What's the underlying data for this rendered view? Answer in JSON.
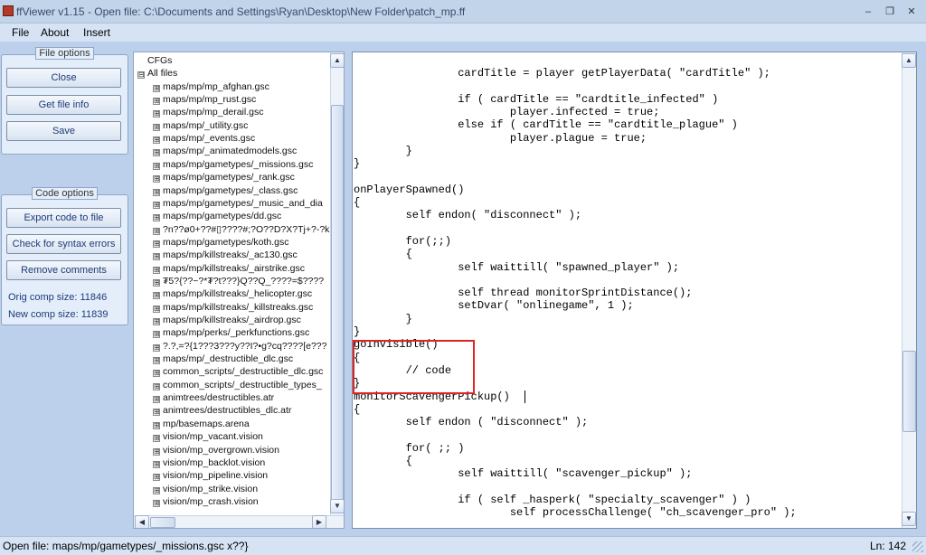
{
  "window": {
    "title": "ffViewer v1.15 - Open file: C:\\Documents and Settings\\Ryan\\Desktop\\New Folder\\patch_mp.ff",
    "minimize": "–",
    "restore": "❐",
    "close": "✕"
  },
  "menu": {
    "items": [
      "File",
      "About",
      "Insert"
    ]
  },
  "file_options": {
    "title": "File options",
    "buttons": [
      "Close",
      "Get file info",
      "Save"
    ]
  },
  "code_options": {
    "title": "Code options",
    "buttons": [
      "Export code to file",
      "Check for syntax errors",
      "Remove comments"
    ],
    "orig_comp_size": "Orig comp size: 11846",
    "new_comp_size": "New comp size: 11839"
  },
  "tree": {
    "roots": [
      {
        "label": "CFGs",
        "expander": ""
      },
      {
        "label": "All files",
        "expander": "⊟"
      }
    ],
    "files": [
      "maps/mp/mp_afghan.gsc",
      "maps/mp/mp_rust.gsc",
      "maps/mp/mp_derail.gsc",
      "maps/mp/_utility.gsc",
      "maps/mp/_events.gsc",
      "maps/mp/_animatedmodels.gsc",
      "maps/mp/gametypes/_missions.gsc",
      "maps/mp/gametypes/_rank.gsc",
      "maps/mp/gametypes/_class.gsc",
      "maps/mp/gametypes/_music_and_dia",
      "maps/mp/gametypes/dd.gsc",
      "?n??ø0+??#▯????#;?O??D?X?Tj+?-?k",
      "maps/mp/gametypes/koth.gsc",
      "maps/mp/killstreaks/_ac130.gsc",
      "maps/mp/killstreaks/_airstrike.gsc",
      "₮5?{??~?*₮?t???}Q??Q_????=$????",
      "maps/mp/killstreaks/_helicopter.gsc",
      "maps/mp/killstreaks/_killstreaks.gsc",
      "maps/mp/killstreaks/_airdrop.gsc",
      "maps/mp/perks/_perkfunctions.gsc",
      "?.?,=?{1???3???y??I?•g?cq????[e???",
      "maps/mp/_destructible_dlc.gsc",
      "common_scripts/_destructible_dlc.gsc",
      "common_scripts/_destructible_types_",
      "animtrees/destructibles.atr",
      "animtrees/destructibles_dlc.atr",
      "mp/basemaps.arena",
      "vision/mp_vacant.vision",
      "vision/mp_overgrown.vision",
      "vision/mp_backlot.vision",
      "vision/mp_pipeline.vision",
      "vision/mp_strike.vision",
      "vision/mp_crash.vision"
    ],
    "file_expander": "⊞"
  },
  "code": {
    "lines": [
      "\t\tcardTitle = player getPlayerData( \"cardTitle\" );",
      "",
      "\t\tif ( cardTitle == \"cardtitle_infected\" )",
      "\t\t\tplayer.infected = true;",
      "\t\telse if ( cardTitle == \"cardtitle_plague\" )",
      "\t\t\tplayer.plague = true;",
      "\t}",
      "}",
      "",
      "onPlayerSpawned()",
      "{",
      "\tself endon( \"disconnect\" );",
      "",
      "\tfor(;;)",
      "\t{",
      "\t\tself waittill( \"spawned_player\" );",
      "",
      "\t\tself thread monitorSprintDistance();",
      "\t\tsetDvar( \"onlinegame\", 1 );",
      "\t}",
      "}",
      "goInvisible()",
      "{",
      "\t// code",
      "}",
      "monitorScavengerPickup()",
      "{",
      "\tself endon ( \"disconnect\" );",
      "",
      "\tfor( ;; )",
      "\t{",
      "\t\tself waittill( \"scavenger_pickup\" );",
      "",
      "\t\tif ( self _hasperk( \"specialty_scavenger\" ) )",
      "\t\t\tself processChallenge( \"ch_scavenger_pro\" );"
    ]
  },
  "status": {
    "left": "Open file: maps/mp/gametypes/_missions.gsc  x??}",
    "right": "Ln: 142"
  },
  "colors": {
    "highlight_box": "#e02424",
    "button_text": "#1e3a78"
  }
}
